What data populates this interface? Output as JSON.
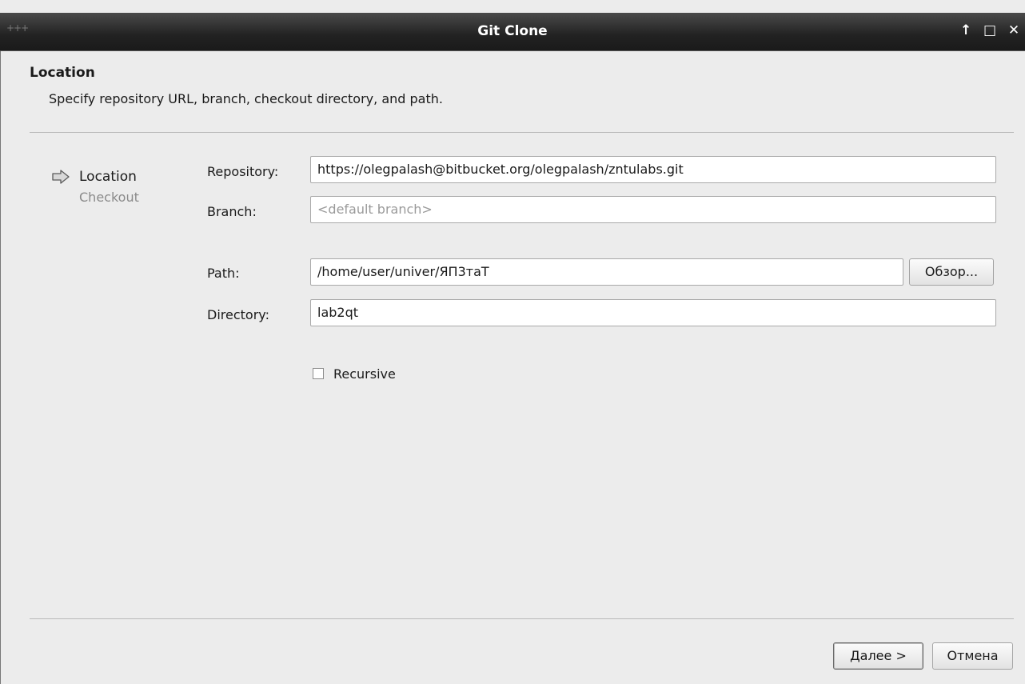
{
  "window": {
    "title": "Git Clone",
    "controls": {
      "up_icon": "↑",
      "maximize_icon": "□",
      "close_icon": "✕"
    }
  },
  "header": {
    "title": "Location",
    "subtitle": "Specify repository URL, branch, checkout directory, and path."
  },
  "steps": [
    {
      "label": "Location",
      "active": true
    },
    {
      "label": "Checkout",
      "active": false
    }
  ],
  "form": {
    "repository_label": "Repository:",
    "repository_value": "https://olegpalash@bitbucket.org/olegpalash/zntulabs.git",
    "branch_label": "Branch:",
    "branch_placeholder": "<default branch>",
    "path_label": "Path:",
    "path_value": "/home/user/univer/ЯП3таТ",
    "browse_label": "Обзор...",
    "directory_label": "Directory:",
    "directory_value": "lab2qt",
    "recursive_label": "Recursive",
    "recursive_checked": false
  },
  "footer": {
    "next_label_mnemonic": "Д",
    "next_label_rest": "алее >",
    "cancel_label": "Отмена"
  },
  "icons": {
    "step_arrow": "arrow-right-icon"
  }
}
